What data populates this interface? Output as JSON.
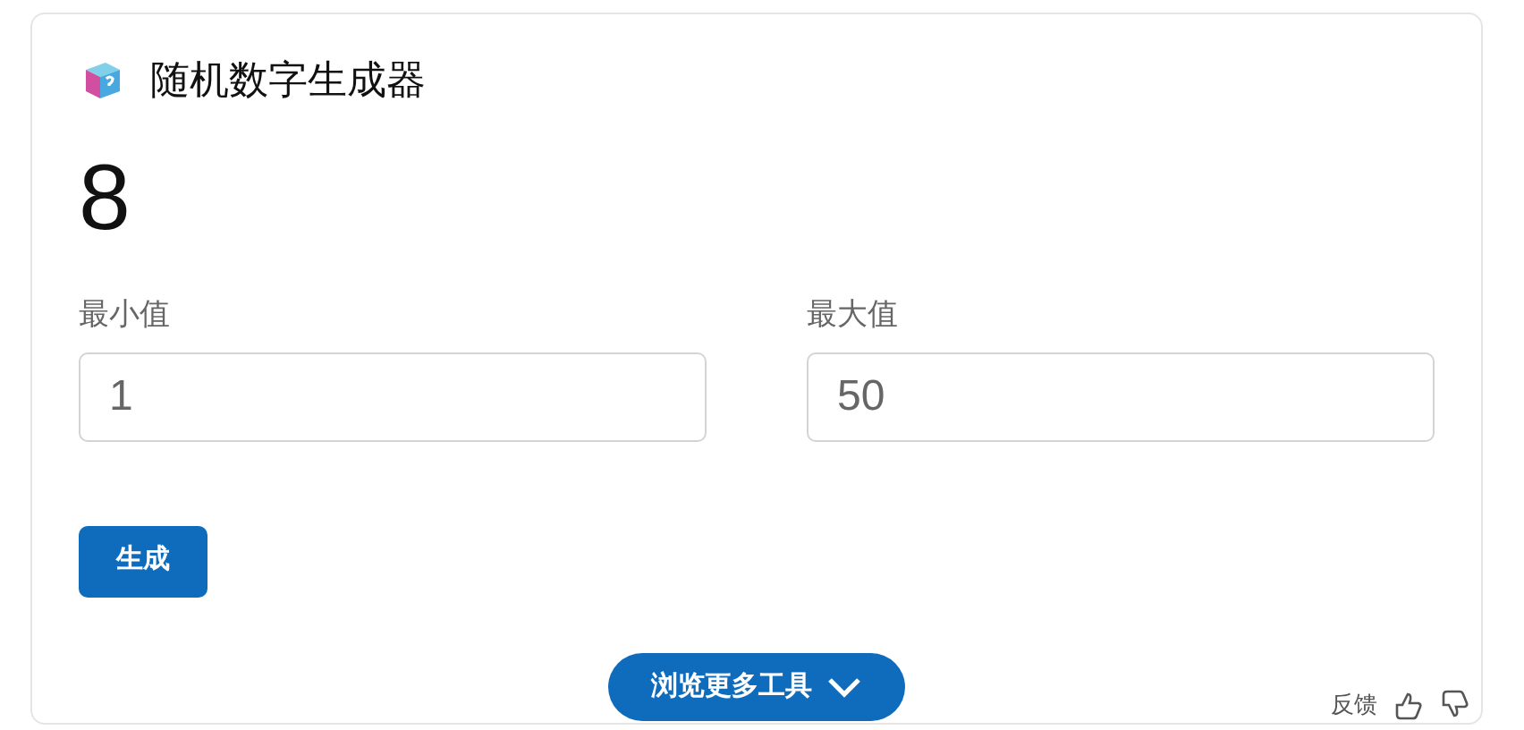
{
  "title": "随机数字生成器",
  "result": "8",
  "fields": [
    {
      "label": "最小值",
      "value": "1"
    },
    {
      "label": "最大值",
      "value": "50"
    }
  ],
  "generate_button": "生成",
  "more_tools_button": "浏览更多工具",
  "feedback": {
    "label": "反馈"
  }
}
